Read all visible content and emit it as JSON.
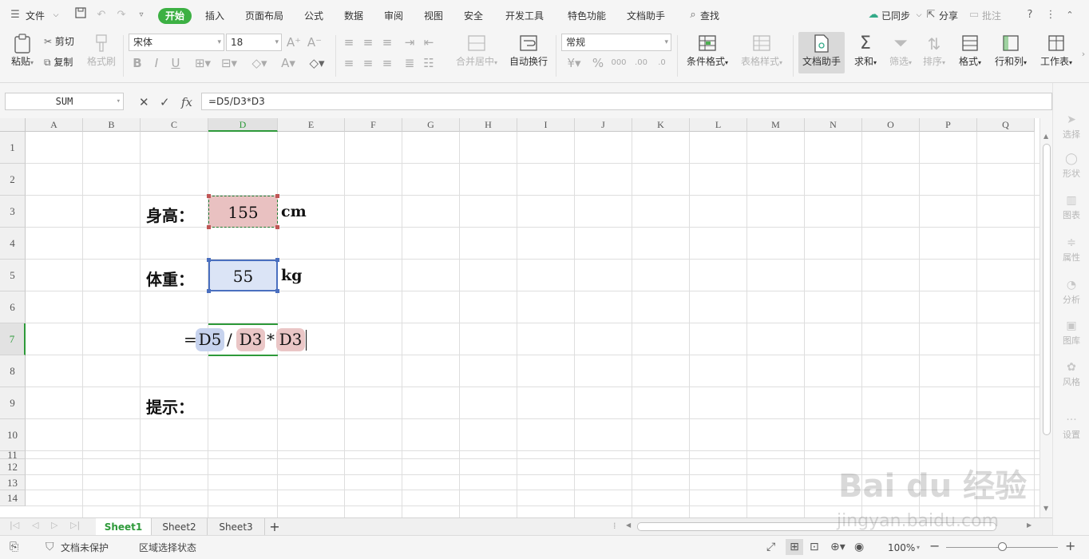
{
  "menubar": {
    "file": "文件",
    "tabs": [
      "开始",
      "插入",
      "页面布局",
      "公式",
      "数据",
      "审阅",
      "视图",
      "安全",
      "开发工具",
      "特色功能",
      "文档助手"
    ],
    "search": "查找",
    "synced": "已同步",
    "share": "分享",
    "comment": "批注"
  },
  "ribbon": {
    "paste": "粘贴",
    "cut": "剪切",
    "copy": "复制",
    "format_painter": "格式刷",
    "font_name": "宋体",
    "font_size": "18",
    "merge_center": "合并居中",
    "wrap_text": "自动换行",
    "number_format": "常规",
    "cond_format": "条件格式",
    "table_style": "表格样式",
    "doc_assistant": "文档助手",
    "sum": "求和",
    "filter": "筛选",
    "sort": "排序",
    "format": "格式",
    "row_col": "行和列",
    "worksheet": "工作表"
  },
  "formula_bar": {
    "name_box": "SUM",
    "fx": "fx",
    "formula": "=D5/D3*D3"
  },
  "grid": {
    "columns": [
      "A",
      "B",
      "C",
      "D",
      "E",
      "F",
      "G",
      "H",
      "I",
      "J",
      "K",
      "L",
      "M",
      "N",
      "O",
      "P",
      "Q"
    ],
    "rows": [
      "1",
      "2",
      "3",
      "4",
      "5",
      "6",
      "7",
      "8",
      "9",
      "10",
      "11",
      "12",
      "13",
      "14"
    ],
    "selected_column": "D",
    "selected_row": "7"
  },
  "cells": {
    "height_label": "身高：",
    "height_value": "155",
    "height_unit": "cm",
    "weight_label": "体重：",
    "weight_value": "55",
    "weight_unit": "kg",
    "formula_eq": "=",
    "ref1": "D5",
    "op1": "/",
    "ref2": "D3",
    "op2": "*",
    "ref3": "D3",
    "hint_label": "提示："
  },
  "side_panel": [
    "选择",
    "形状",
    "图表",
    "属性",
    "分析",
    "图库",
    "风格",
    "设置"
  ],
  "sheets": [
    "Sheet1",
    "Sheet2",
    "Sheet3"
  ],
  "status": {
    "doc_protect": "文档未保护",
    "region_select": "区域选择状态",
    "zoom": "100%"
  },
  "watermark": {
    "brand": "Bai du 经验",
    "url": "jingyan.baidu.com"
  },
  "colors": {
    "accent_green": "#3cb043",
    "ref_blue": "#c7d3ee",
    "ref_red": "#eac6c6"
  }
}
